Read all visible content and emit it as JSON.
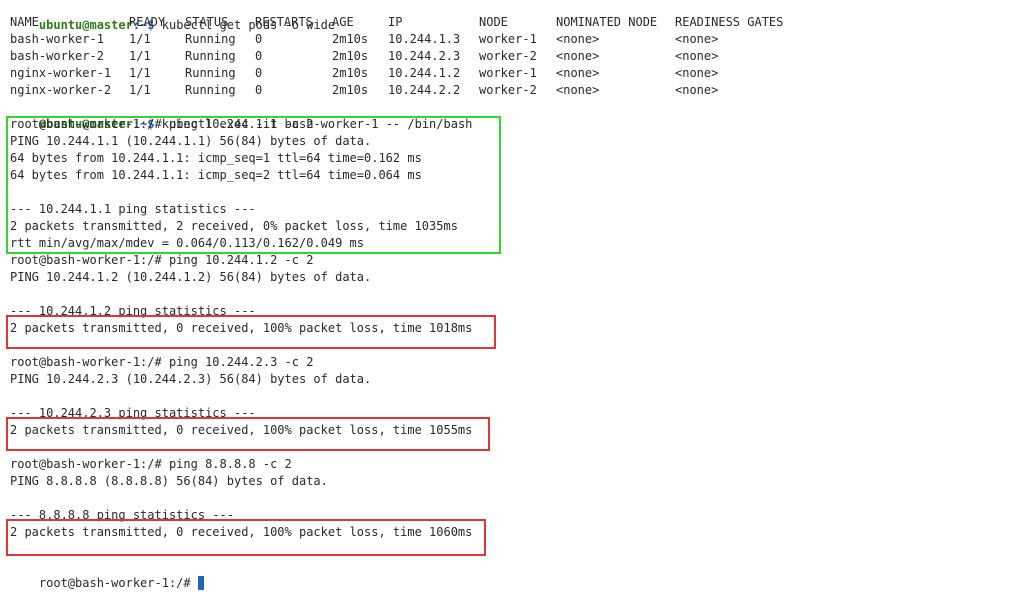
{
  "header": {
    "user_host": "ubuntu@master",
    "path": ":~$",
    "command": " kubectl get pods -o wide"
  },
  "table": {
    "columns": [
      "NAME",
      "READY",
      "STATUS",
      "RESTARTS",
      "AGE",
      "IP",
      "NODE",
      "NOMINATED NODE",
      "READINESS GATES"
    ],
    "rows": [
      [
        "bash-worker-1",
        "1/1",
        "Running",
        "0",
        "2m10s",
        "10.244.1.3",
        "worker-1",
        "<none>",
        "<none>"
      ],
      [
        "bash-worker-2",
        "1/1",
        "Running",
        "0",
        "2m10s",
        "10.244.2.3",
        "worker-2",
        "<none>",
        "<none>"
      ],
      [
        "nginx-worker-1",
        "1/1",
        "Running",
        "0",
        "2m10s",
        "10.244.1.2",
        "worker-1",
        "<none>",
        "<none>"
      ],
      [
        "nginx-worker-2",
        "1/1",
        "Running",
        "0",
        "2m10s",
        "10.244.2.2",
        "worker-2",
        "<none>",
        "<none>"
      ]
    ]
  },
  "exec": {
    "user_host": "ubuntu@master",
    "path": ":~$",
    "command": " kubectl exec -it bash-worker-1 -- /bin/bash"
  },
  "lines": [
    "root@bash-worker-1:/# ping 10.244.1.1 -c 2",
    "PING 10.244.1.1 (10.244.1.1) 56(84) bytes of data.",
    "64 bytes from 10.244.1.1: icmp_seq=1 ttl=64 time=0.162 ms",
    "64 bytes from 10.244.1.1: icmp_seq=2 ttl=64 time=0.064 ms",
    "",
    "--- 10.244.1.1 ping statistics ---",
    "2 packets transmitted, 2 received, 0% packet loss, time 1035ms",
    "rtt min/avg/max/mdev = 0.064/0.113/0.162/0.049 ms",
    "root@bash-worker-1:/# ping 10.244.1.2 -c 2",
    "PING 10.244.1.2 (10.244.1.2) 56(84) bytes of data.",
    "",
    "--- 10.244.1.2 ping statistics ---",
    "2 packets transmitted, 0 received, 100% packet loss, time 1018ms",
    "",
    "root@bash-worker-1:/# ping 10.244.2.3 -c 2",
    "PING 10.244.2.3 (10.244.2.3) 56(84) bytes of data.",
    "",
    "--- 10.244.2.3 ping statistics ---",
    "2 packets transmitted, 0 received, 100% packet loss, time 1055ms",
    "",
    "root@bash-worker-1:/# ping 8.8.8.8 -c 2",
    "PING 8.8.8.8 (8.8.8.8) 56(84) bytes of data.",
    "",
    "--- 8.8.8.8 ping statistics ---",
    "2 packets transmitted, 0 received, 100% packet loss, time 1060ms",
    "",
    "root@bash-worker-1:/# "
  ],
  "highlights": {
    "success_color": "#35d631",
    "failure_color": "#e23636",
    "cursor_color": "#1a66c4"
  }
}
